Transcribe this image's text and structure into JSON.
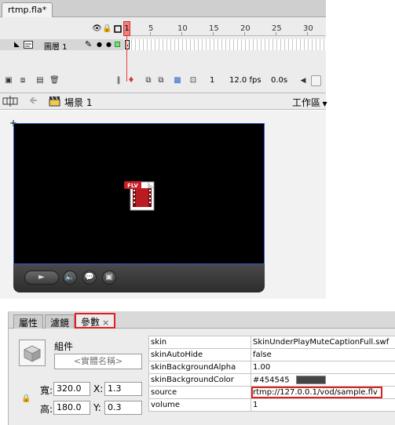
{
  "document": {
    "tab_title": "rtmp.fla*"
  },
  "timeline": {
    "frame_numbers": [
      "1",
      "5",
      "10",
      "15",
      "20",
      "25",
      "30"
    ],
    "layer": {
      "name": "圖層 1"
    },
    "status": {
      "current_frame": "1",
      "fps": "12.0 fps",
      "elapsed": "0.0s"
    }
  },
  "edit_bar": {
    "scene": "場景 1",
    "workspace": "工作區"
  },
  "stage": {
    "background": "#f2f2f2",
    "video_color": "#000000",
    "video_border": "#3359c8",
    "flv_icon_label": "FLV"
  },
  "panel": {
    "tabs": [
      {
        "label": "屬性",
        "active": false
      },
      {
        "label": "濾鏡",
        "active": false
      },
      {
        "label": "參數",
        "active": true,
        "close": "×"
      }
    ],
    "component_label": "組件",
    "instance_name_placeholder": "<實體名稱>",
    "fields": {
      "width_label": "寬:",
      "width": "320.0",
      "height_label": "高:",
      "height": "180.0",
      "x_label": "X:",
      "x": "1.3",
      "y_label": "Y:",
      "y": "0.3"
    },
    "params": [
      {
        "name": "skin",
        "value": "SkinUnderPlayMuteCaptionFull.swf"
      },
      {
        "name": "skinAutoHide",
        "value": "false"
      },
      {
        "name": "skinBackgroundAlpha",
        "value": "1.00"
      },
      {
        "name": "skinBackgroundColor",
        "value": "#454545",
        "swatch": "#454545"
      },
      {
        "name": "source",
        "value": "rtmp://127.0.0.1/vod/sample.flv",
        "highlight": true
      },
      {
        "name": "volume",
        "value": "1"
      }
    ],
    "highlight_color": "#e02020"
  }
}
